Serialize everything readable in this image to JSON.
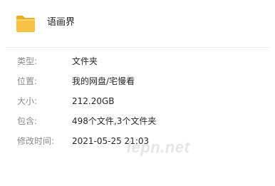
{
  "folder": {
    "name": "语画界",
    "icon": "folder-icon"
  },
  "properties": [
    {
      "label": "类型:",
      "value": "文件夹"
    },
    {
      "label": "位置:",
      "value": "我的网盘/宅慢看"
    },
    {
      "label": "大小:",
      "value": "212.20GB"
    },
    {
      "label": "包含:",
      "value": "498个文件,3个文件夹"
    },
    {
      "label": "修改时间:",
      "value": "2021-05-25 21:03"
    }
  ],
  "watermark": "lepn.net",
  "colors": {
    "folder_body": "#F7C243",
    "folder_tab": "#E8AE2A",
    "label": "#8A8A8A",
    "value": "#262626"
  }
}
